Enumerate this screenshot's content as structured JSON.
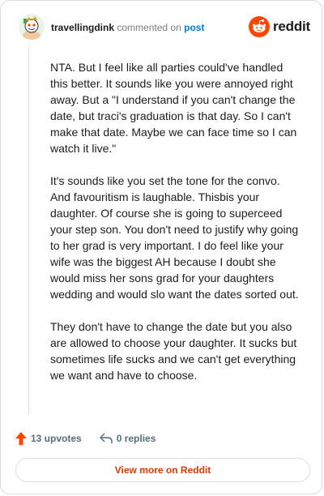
{
  "header": {
    "username": "travellingdink",
    "action_text": "commented on",
    "post_link": "post",
    "brand": "reddit",
    "avatar_icon": "snoo-avatar-icon",
    "brand_icon": "reddit-alien-icon",
    "brand_color": "#ff4500"
  },
  "comment": {
    "paragraphs": [
      "NTA. But I feel like all parties could've handled this better. It sounds like you were annoyed right away. But a \"I understand if you can't change the date, but traci's graduation is that day. So I can't make that date. Maybe we can face time so I can watch it live.\"",
      "It's sounds like you set the tone for the convo. And favouritism is laughable. Thisbis your daughter. Of course she is going to superceed your step son. You don't need to justify why going to her grad is very important. I do feel like your wife was the biggest AH because I doubt she would miss her sons grad for your daughters wedding and would slo want the dates sorted out.",
      "They don't have to change the date but you also are allowed to choose your daughter. It sucks but sometimes life sucks and we can't get everything we want and have to choose."
    ]
  },
  "actions": {
    "upvotes": "13 upvotes",
    "replies": "0 replies",
    "upvote_color": "#ff4500"
  },
  "footer": {
    "view_more": "View more on Reddit",
    "view_more_color": "#d93a00"
  }
}
